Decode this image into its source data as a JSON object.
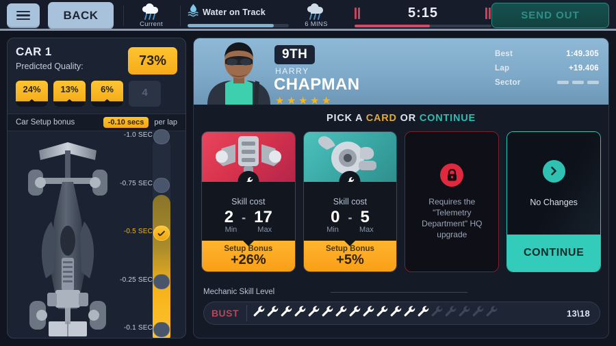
{
  "topbar": {
    "menu_icon": "hamburger-menu-icon",
    "back_label": "BACK",
    "weather_current": {
      "icon": "rain-cloud-icon",
      "label": "Current"
    },
    "track_condition": {
      "icon": "water-droplet-icon",
      "label": "Water on Track",
      "fill_percent": 85
    },
    "weather_forecast": {
      "icon": "rain-cloud-icon",
      "label": "6 MINS"
    },
    "timer": {
      "value": "5:15",
      "fill_percent": 55,
      "pause_icon": "pause-icon"
    },
    "send_out_label": "SEND OUT"
  },
  "left_panel": {
    "car_title": "CAR 1",
    "predicted_quality_label": "Predicted Quality:",
    "quality_total": "73%",
    "quality_badges": [
      "24%",
      "13%",
      "6%"
    ],
    "empty_slot": "4",
    "setup_bonus_label": "Car Setup bonus",
    "setup_bonus_value": "-0.10 secs",
    "setup_bonus_suffix": "per lap",
    "car_icon": "f1-car-topdown-icon",
    "ladder": [
      {
        "label": "-1.0 SEC",
        "selected": false
      },
      {
        "label": "-0.75 SEC",
        "selected": false
      },
      {
        "label": "-0.5 SEC",
        "selected": true
      },
      {
        "label": "-0.25 SEC",
        "selected": false
      },
      {
        "label": "-0.1 SEC",
        "selected": false
      }
    ]
  },
  "driver": {
    "position": "9TH",
    "first_name": "HARRY",
    "last_name": "CHAPMAN",
    "stars": 5,
    "portrait_icon": "driver-portrait-icon",
    "stats": [
      {
        "key": "Best",
        "value": "1:49.305"
      },
      {
        "key": "Lap",
        "value": "+19.406"
      },
      {
        "key": "Sector",
        "value": ""
      }
    ],
    "sector_segments": 3
  },
  "pick": {
    "prefix": "PICK A ",
    "card_word": "CARD",
    "middle": " OR ",
    "continue_word": "CONTINUE"
  },
  "cards": [
    {
      "type": "pick",
      "part_icon": "engine-part-icon",
      "wrench_icon": "wrench-icon",
      "skill_cost_label": "Skill cost",
      "min_value": "2",
      "dash": "-",
      "max_value": "17",
      "min_label": "Min",
      "max_label": "Max",
      "footer_label": "Setup Bonus",
      "footer_value": "+26%"
    },
    {
      "type": "pick",
      "part_icon": "turbo-part-icon",
      "wrench_icon": "wrench-icon",
      "skill_cost_label": "Skill cost",
      "min_value": "0",
      "dash": "-",
      "max_value": "5",
      "min_label": "Min",
      "max_label": "Max",
      "footer_label": "Setup Bonus",
      "footer_value": "+5%"
    },
    {
      "type": "locked",
      "lock_icon": "lock-icon",
      "message": "Requires the \"Telemetry Department\" HQ upgrade"
    },
    {
      "type": "continue",
      "arrow_icon": "chevron-right-icon",
      "no_changes_label": "No Changes",
      "button_label": "CONTINUE"
    }
  ],
  "mechanic": {
    "label": "Mechanic Skill Level",
    "bust_label": "BUST",
    "filled": 13,
    "total": 18,
    "count_text": "13\\18",
    "wrench_icon": "wrench-icon"
  },
  "colors": {
    "gold": "#f6b61b",
    "teal": "#33ccbb",
    "red": "#d24a63",
    "panel": "#1b2231",
    "bg": "#11151f"
  }
}
